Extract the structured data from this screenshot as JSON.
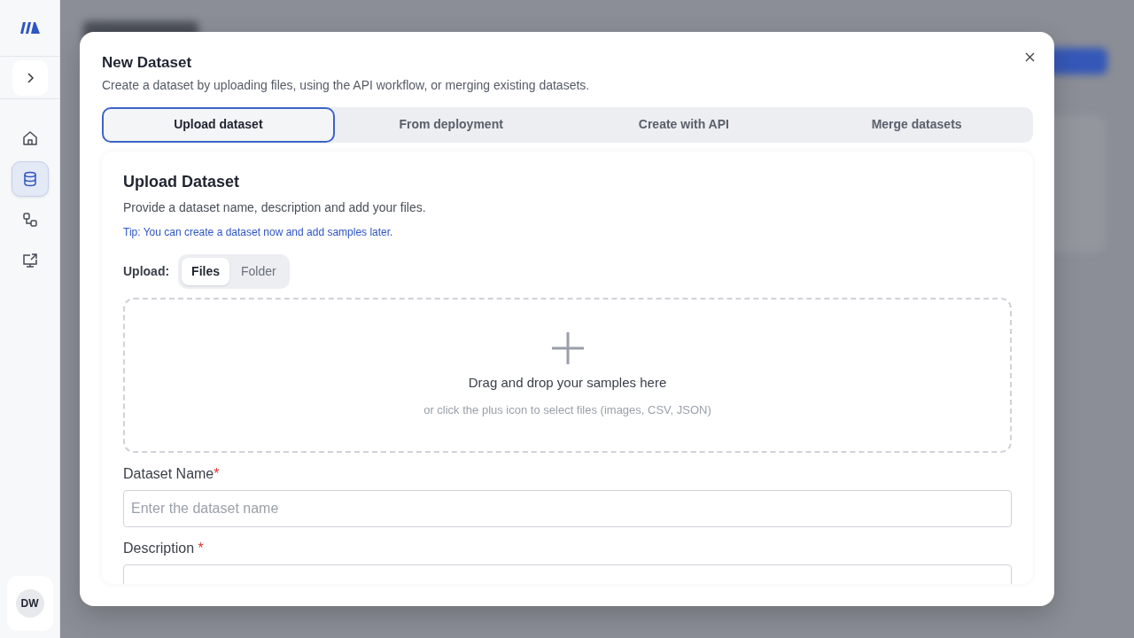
{
  "sidebar": {
    "avatar": "DW",
    "items": [
      {
        "selected": false
      },
      {
        "selected": true
      },
      {
        "selected": false
      },
      {
        "selected": false
      }
    ]
  },
  "modal": {
    "title": "New Dataset",
    "subtitle": "Create a dataset by uploading files, using the API workflow, or merging existing datasets.",
    "tabs": [
      {
        "label": "Upload dataset",
        "selected": true
      },
      {
        "label": "From deployment",
        "selected": false
      },
      {
        "label": "Create with API",
        "selected": false
      },
      {
        "label": "Merge datasets",
        "selected": false
      }
    ],
    "section": {
      "title": "Upload Dataset",
      "description": "Provide a dataset name, description and add your files.",
      "tip": "Tip: You can create a dataset now and add samples later.",
      "upload_label": "Upload:",
      "upload_modes": [
        {
          "label": "Files",
          "selected": true
        },
        {
          "label": "Folder",
          "selected": false
        }
      ],
      "dropzone": {
        "title": "Drag and drop your samples here",
        "hint": "or click the plus icon to select files (images, CSV, JSON)"
      },
      "fields": [
        {
          "label": "Dataset Name",
          "required_mark": "*",
          "placeholder": "Enter the dataset name"
        },
        {
          "label": "Description",
          "required_mark": "*"
        }
      ]
    }
  }
}
